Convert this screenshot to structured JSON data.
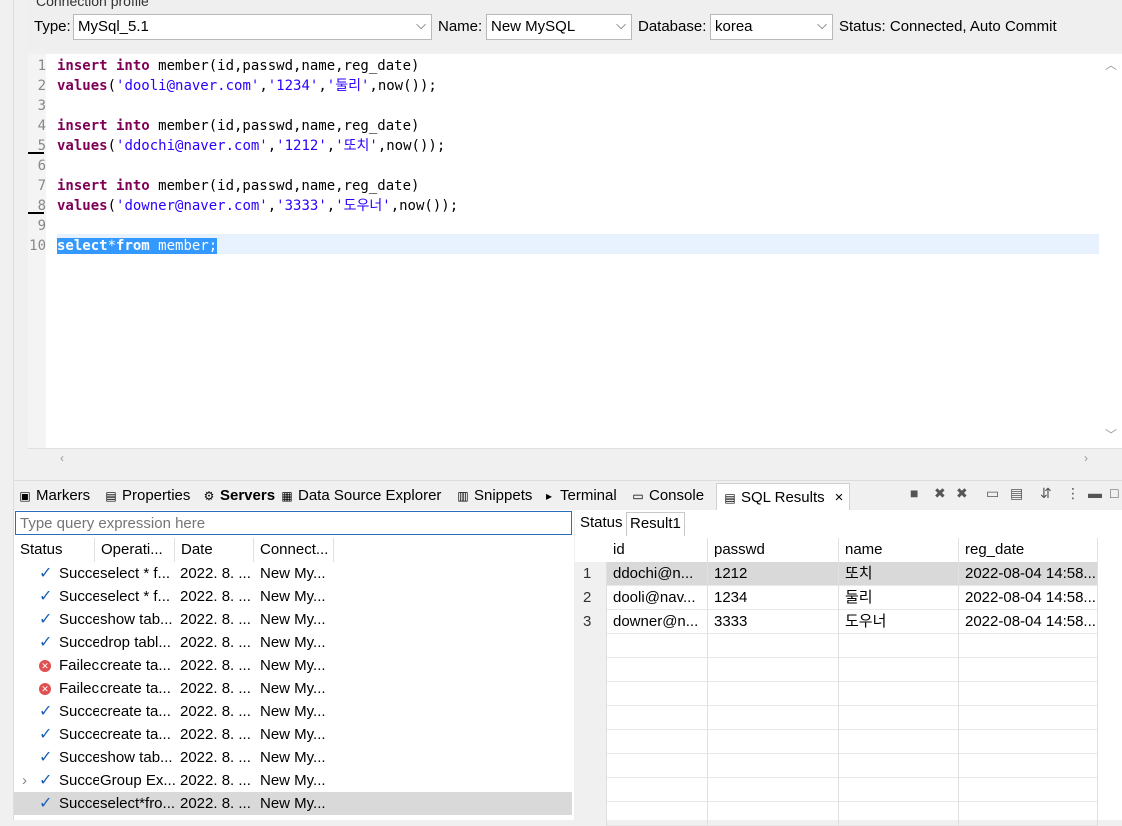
{
  "profile": {
    "title": "Connection profile",
    "type_label": "Type:",
    "type_value": "MySql_5.1",
    "name_label": "Name:",
    "name_value": "New MySQL",
    "database_label": "Database:",
    "database_value": "korea",
    "status": "Status: Connected, Auto Commit"
  },
  "editor": {
    "lines": [
      {
        "no": "1",
        "parts": [
          {
            "k": "kw",
            "t": "insert into"
          },
          {
            "k": "",
            "t": " member(id,passwd,name,reg_date)"
          }
        ]
      },
      {
        "no": "2",
        "parts": [
          {
            "k": "kw",
            "t": "values"
          },
          {
            "k": "",
            "t": "("
          },
          {
            "k": "str",
            "t": "'dooli@naver.com'"
          },
          {
            "k": "",
            "t": ","
          },
          {
            "k": "str",
            "t": "'1234'"
          },
          {
            "k": "",
            "t": ","
          },
          {
            "k": "str",
            "t": "'둘리'"
          },
          {
            "k": "",
            "t": ",now());"
          }
        ]
      },
      {
        "no": "3",
        "parts": []
      },
      {
        "no": "4",
        "parts": [
          {
            "k": "kw",
            "t": "insert into"
          },
          {
            "k": "",
            "t": " member(id,passwd,name,reg_date)"
          }
        ]
      },
      {
        "no": "5",
        "parts": [
          {
            "k": "kw",
            "t": "values"
          },
          {
            "k": "",
            "t": "("
          },
          {
            "k": "str",
            "t": "'ddochi@naver.com'"
          },
          {
            "k": "",
            "t": ","
          },
          {
            "k": "str",
            "t": "'1212'"
          },
          {
            "k": "",
            "t": ","
          },
          {
            "k": "str",
            "t": "'또치'"
          },
          {
            "k": "",
            "t": ",now());"
          }
        ]
      },
      {
        "no": "6",
        "parts": []
      },
      {
        "no": "7",
        "parts": [
          {
            "k": "kw",
            "t": "insert into"
          },
          {
            "k": "",
            "t": " member(id,passwd,name,reg_date)"
          }
        ]
      },
      {
        "no": "8",
        "parts": [
          {
            "k": "kw",
            "t": "values"
          },
          {
            "k": "",
            "t": "("
          },
          {
            "k": "str",
            "t": "'downer@naver.com'"
          },
          {
            "k": "",
            "t": ","
          },
          {
            "k": "str",
            "t": "'3333'"
          },
          {
            "k": "",
            "t": ","
          },
          {
            "k": "str",
            "t": "'도우너'"
          },
          {
            "k": "",
            "t": ",now());"
          }
        ]
      },
      {
        "no": "9",
        "parts": []
      },
      {
        "no": "10",
        "selected": true,
        "parts": [
          {
            "k": "kw",
            "t": "select"
          },
          {
            "k": "",
            "t": "*"
          },
          {
            "k": "kw",
            "t": "from"
          },
          {
            "k": "",
            "t": " member;"
          }
        ]
      }
    ]
  },
  "views": {
    "tabs": [
      {
        "label": "Markers",
        "icon": "markers-icon",
        "glyph": "▣"
      },
      {
        "label": "Properties",
        "icon": "properties-icon",
        "glyph": "▤"
      },
      {
        "label": "Servers",
        "icon": "servers-icon",
        "glyph": "⚙"
      },
      {
        "label": "Data Source Explorer",
        "icon": "data-source-icon",
        "glyph": "▦"
      },
      {
        "label": "Snippets",
        "icon": "snippets-icon",
        "glyph": "▥"
      },
      {
        "label": "Terminal",
        "icon": "terminal-icon",
        "glyph": "▸"
      },
      {
        "label": "Console",
        "icon": "console-icon",
        "glyph": "▭"
      },
      {
        "label": "SQL Results",
        "icon": "sql-results-icon",
        "glyph": "▤"
      }
    ],
    "close_glyph": "×"
  },
  "history": {
    "placeholder": "Type query expression here",
    "columns": [
      "Status",
      "Operati...",
      "Date",
      "Connect..."
    ],
    "rows": [
      {
        "status": "Succe",
        "ok": true,
        "op": "select * f...",
        "date": "2022. 8. ...",
        "conn": "New My..."
      },
      {
        "status": "Succe",
        "ok": true,
        "op": "select * f...",
        "date": "2022. 8. ...",
        "conn": "New My..."
      },
      {
        "status": "Succe",
        "ok": true,
        "op": "show tab...",
        "date": "2022. 8. ...",
        "conn": "New My..."
      },
      {
        "status": "Succe",
        "ok": true,
        "op": "drop tabl...",
        "date": "2022. 8. ...",
        "conn": "New My..."
      },
      {
        "status": "Failec",
        "ok": false,
        "op": "create ta...",
        "date": "2022. 8. ...",
        "conn": "New My..."
      },
      {
        "status": "Failec",
        "ok": false,
        "op": "create ta...",
        "date": "2022. 8. ...",
        "conn": "New My..."
      },
      {
        "status": "Succe",
        "ok": true,
        "op": "create ta...",
        "date": "2022. 8. ...",
        "conn": "New My..."
      },
      {
        "status": "Succe",
        "ok": true,
        "op": "create ta...",
        "date": "2022. 8. ...",
        "conn": "New My..."
      },
      {
        "status": "Succe",
        "ok": true,
        "op": "show tab...",
        "date": "2022. 8. ...",
        "conn": "New My..."
      },
      {
        "status": "Succe",
        "ok": true,
        "op": "Group Ex...",
        "date": "2022. 8. ...",
        "conn": "New My...",
        "expandable": true
      },
      {
        "status": "Succe",
        "ok": true,
        "op": "select*fro...",
        "date": "2022. 8. ...",
        "conn": "New My...",
        "selected": true
      }
    ]
  },
  "results": {
    "tabs": [
      "Status",
      "Result1"
    ],
    "columns": [
      "id",
      "passwd",
      "name",
      "reg_date"
    ],
    "rows": [
      {
        "n": "1",
        "id": "ddochi@n...",
        "passwd": "1212",
        "name": "또치",
        "reg_date": "2022-08-04 14:58...",
        "selected": true
      },
      {
        "n": "2",
        "id": "dooli@nav...",
        "passwd": "1234",
        "name": "둘리",
        "reg_date": "2022-08-04 14:58..."
      },
      {
        "n": "3",
        "id": "downer@n...",
        "passwd": "3333",
        "name": "도우너",
        "reg_date": "2022-08-04 14:58..."
      }
    ]
  }
}
